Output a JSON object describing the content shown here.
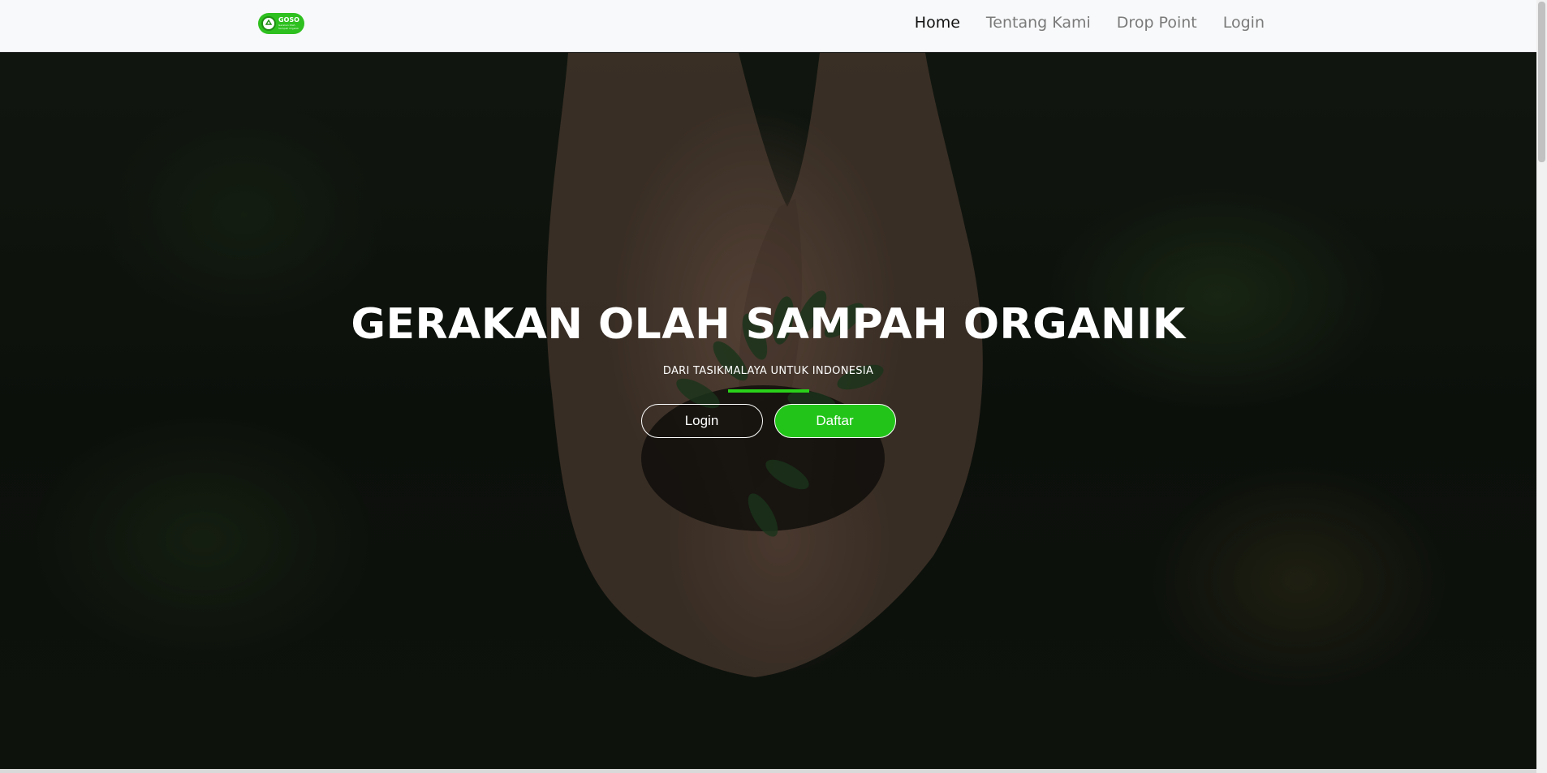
{
  "brand": {
    "logo_text": "GOSO",
    "logo_tagline_1": "Gerakan Olah",
    "logo_tagline_2": "Sampah Organik",
    "accent_color": "#2ec01f"
  },
  "nav": {
    "items": [
      {
        "label": "Home",
        "active": true
      },
      {
        "label": "Tentang Kami",
        "active": false
      },
      {
        "label": "Drop Point",
        "active": false
      },
      {
        "label": "Login",
        "active": false
      }
    ]
  },
  "hero": {
    "title": "GERAKAN OLAH SAMPAH ORGANIK",
    "subtitle": "DARI TASIKMALAYA UNTUK INDONESIA",
    "login_button": "Login",
    "daftar_button": "Daftar",
    "divider_color": "#2ad11a"
  },
  "icons": {
    "logo": "recycle-icon"
  }
}
